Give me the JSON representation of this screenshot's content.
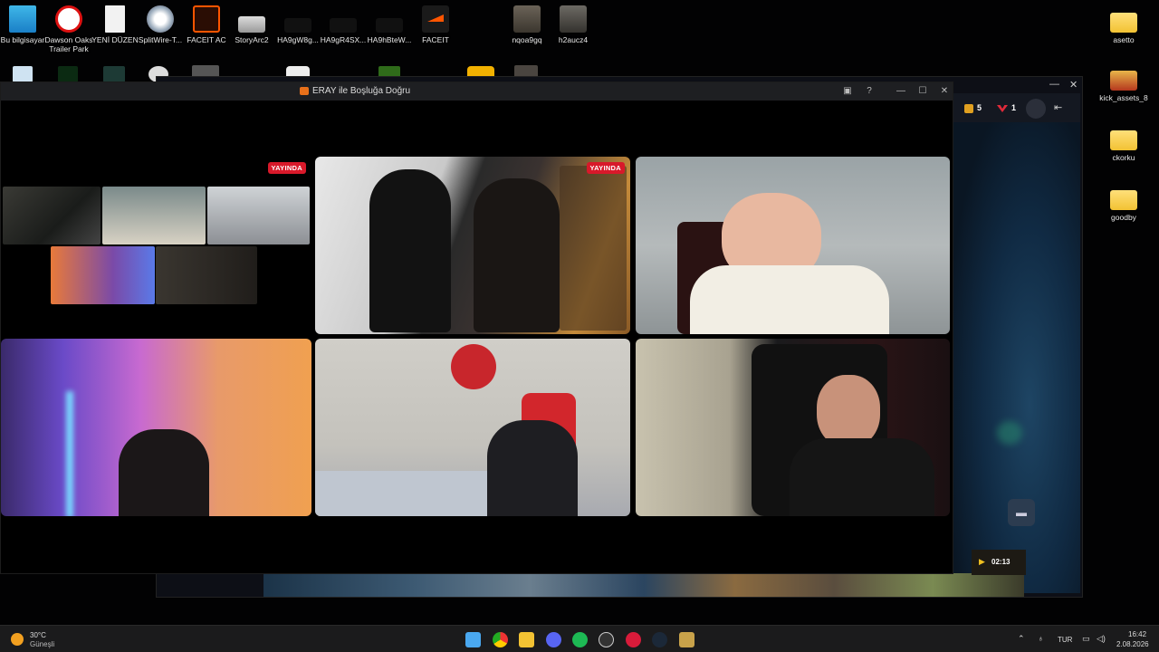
{
  "desktop": {
    "icons_top": [
      {
        "label": "Bu bilgisayar"
      },
      {
        "label": "Dawson Oaks Trailer Park"
      },
      {
        "label": "YENİ DÜZEN"
      },
      {
        "label": "SplitWire-T..."
      },
      {
        "label": "FACEIT AC"
      },
      {
        "label": "StoryArc2"
      },
      {
        "label": "HA9gW8g..."
      },
      {
        "label": "HA9gR4SX..."
      },
      {
        "label": "HA9hBteW..."
      },
      {
        "label": "FACEIT"
      },
      {
        "label": "nqoa9gq"
      },
      {
        "label": "h2aucz4"
      }
    ],
    "icons_right": [
      {
        "label": "asetto"
      },
      {
        "label": "kick_assets_8"
      },
      {
        "label": "ckorku"
      },
      {
        "label": "goodby"
      }
    ]
  },
  "background_window": {
    "viewer_count": "5",
    "sub_count": "1",
    "timer": "02:13"
  },
  "window": {
    "title": "ERAY ile Boşluğa Doğru",
    "live_badge": "YAYINDA",
    "live_badge_2": "YAYINDA"
  },
  "taskbar": {
    "weather_temp": "30°C",
    "weather_desc": "Güneşli",
    "language": "TUR",
    "time": "16:42",
    "date": "2.08.2026"
  },
  "colors": {
    "live_badge": "#d8192a",
    "titlebar": "#1e1f22",
    "taskbar": "#1b1b1c"
  }
}
